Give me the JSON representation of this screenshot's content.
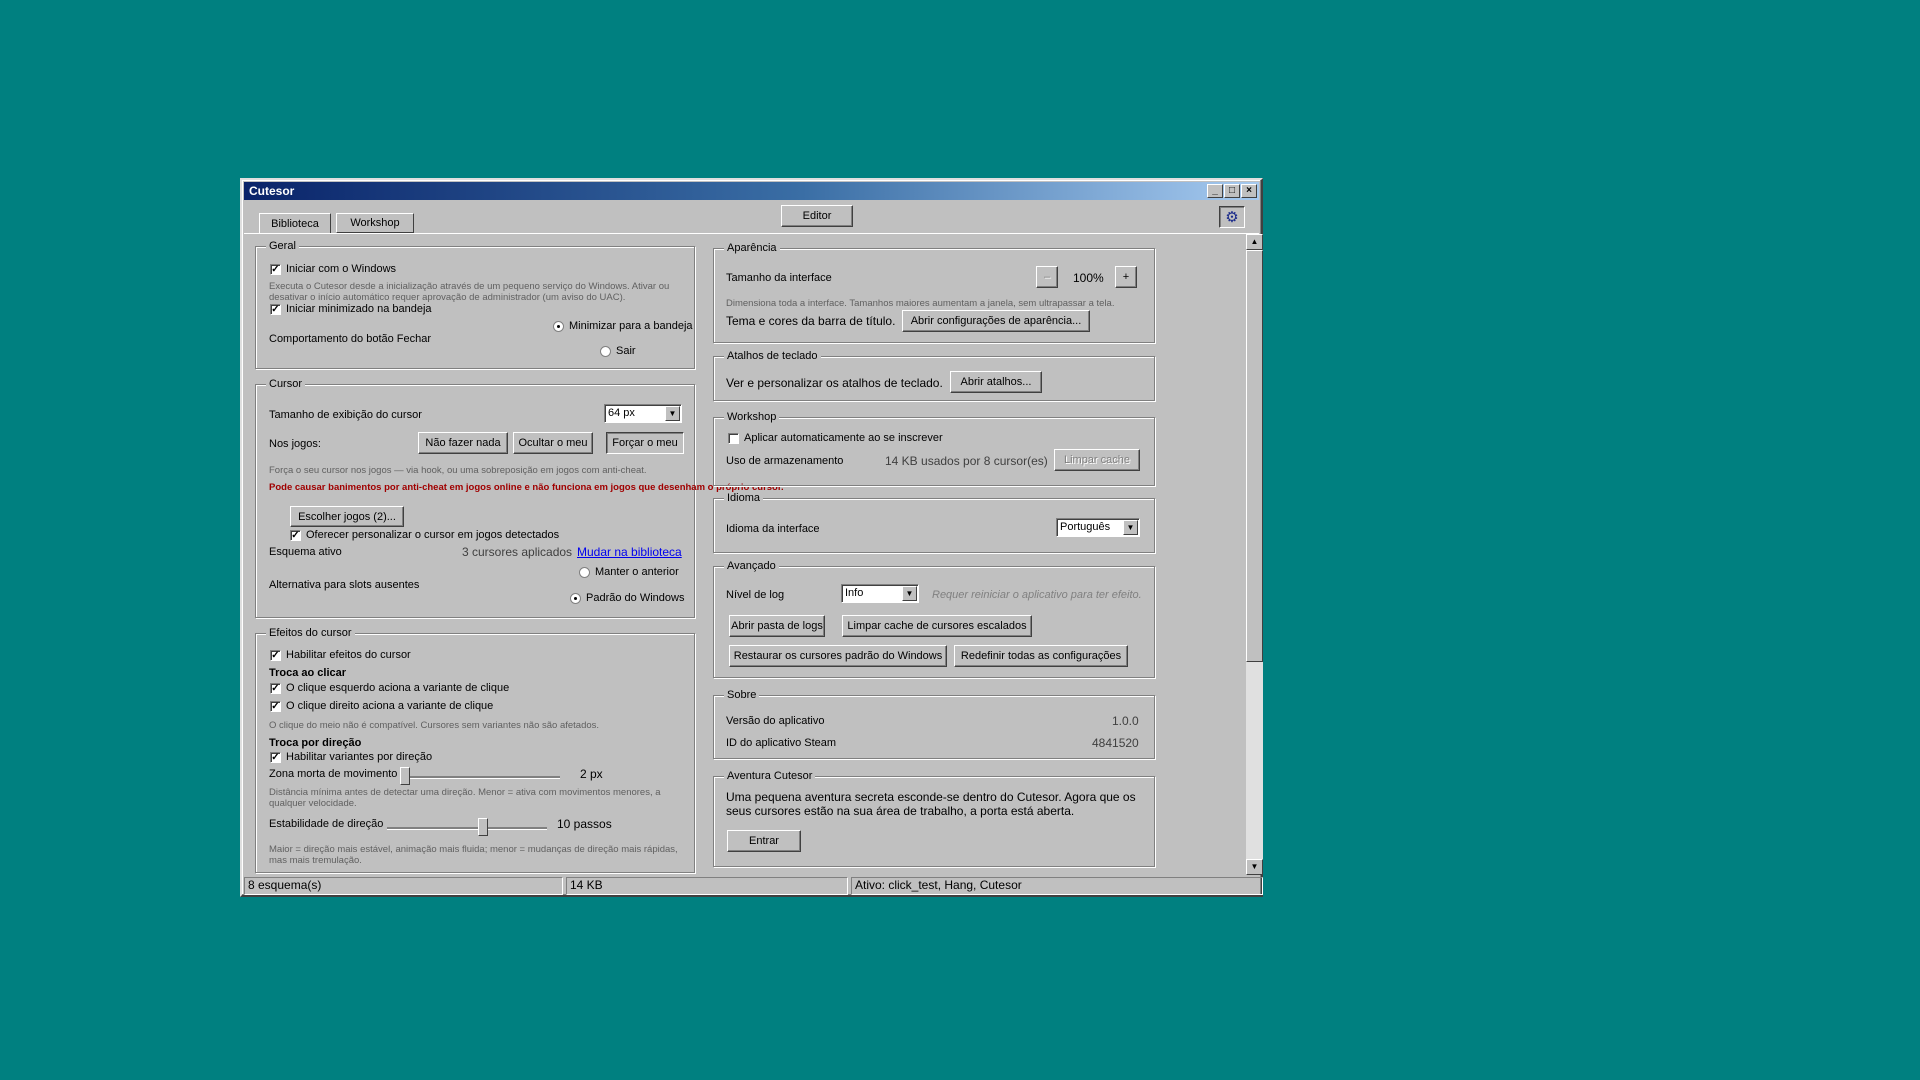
{
  "window": {
    "title": "Cutesor"
  },
  "tabs": [
    {
      "label": "Biblioteca"
    },
    {
      "label": "Workshop"
    }
  ],
  "editor_button": "Editor",
  "settings_icon": "gear-icon",
  "geral": {
    "title": "Geral",
    "start_with_windows": "Iniciar com o Windows",
    "start_desc": "Executa o Cutesor desde a inicialização através de um pequeno serviço do Windows. Ativar ou desativar o início automático requer aprovação de administrador (um aviso do UAC).",
    "start_minimized": "Iniciar minimizado na bandeja",
    "close_behavior": "Comportamento do botão Fechar",
    "minimize_tray": "Minimizar para a bandeja",
    "exit": "Sair"
  },
  "cursor": {
    "title": "Cursor",
    "size_label": "Tamanho de exibição do cursor",
    "size_value": "64 px",
    "games_label": "Nos jogos:",
    "btn_nothing": "Não fazer nada",
    "btn_hide": "Ocultar o meu",
    "btn_force": "Forçar o meu",
    "force_desc": "Força o seu cursor nos jogos — via hook, ou uma sobreposição em jogos com anti-cheat.",
    "warning": "Pode causar banimentos por anti-cheat em jogos online e não funciona em jogos que desenham o próprio cursor.",
    "choose_games": "Escolher jogos (2)...",
    "offer_custom": "Oferecer personalizar o cursor em jogos detectados",
    "active_scheme": "Esquema ativo",
    "cursors_applied": "3 cursores aplicados",
    "change_in_library": "Mudar na biblioteca",
    "keep_previous": "Manter o anterior",
    "fallback": "Alternativa para slots ausentes",
    "windows_default": "Padrão do Windows"
  },
  "effects": {
    "title": "Efeitos do cursor",
    "enable": "Habilitar efeitos do cursor",
    "click_swap": "Troca ao clicar",
    "left_click": "O clique esquerdo aciona a variante de clique",
    "right_click": "O clique direito aciona a variante de clique",
    "middle_note": "O clique do meio não é compatível. Cursores sem variantes não são afetados.",
    "dir_swap": "Troca por direção",
    "enable_dir": "Habilitar variantes por direção",
    "deadzone_label": "Zona morta de movimento",
    "deadzone_value": "2 px",
    "deadzone_level": 0.02,
    "deadzone_desc": "Distância mínima antes de detectar uma direção. Menor = ativa com movimentos menores, a qualquer velocidade.",
    "stability_label": "Estabilidade de direção",
    "stability_value": "10 passos",
    "stability_level": 0.6,
    "stability_desc": "Maior = direção mais estável, animação mais fluida; menor = mudanças de direção mais rápidas, mas mais tremulação."
  },
  "appearance": {
    "title": "Aparência",
    "size_label": "Tamanho da interface",
    "minus": "–",
    "zoom": "100%",
    "plus": "+",
    "desc": "Dimensiona toda a interface. Tamanhos maiores aumentam a janela, sem ultrapassar a tela.",
    "theme_label": "Tema e cores da barra de título.",
    "theme_btn": "Abrir configurações de aparência..."
  },
  "shortcuts": {
    "title": "Atalhos de teclado",
    "label": "Ver e personalizar os atalhos de teclado.",
    "btn": "Abrir atalhos..."
  },
  "workshop": {
    "title": "Workshop",
    "auto_apply": "Aplicar automaticamente ao se inscrever",
    "storage_label": "Uso de armazenamento",
    "storage_value": "14 KB usados por 8 cursor(es)",
    "clear_cache": "Limpar cache"
  },
  "language": {
    "title": "Idioma",
    "label": "Idioma da interface",
    "value": "Português"
  },
  "advanced": {
    "title": "Avançado",
    "log_label": "Nível de log",
    "log_value": "Info",
    "log_note": "Requer reiniciar o aplicativo para ter efeito.",
    "open_logs": "Abrir pasta de logs",
    "clear_scaled": "Limpar cache de cursores escalados",
    "restore_defaults": "Restaurar os cursores padrão do Windows",
    "reset_all": "Redefinir todas as configurações"
  },
  "about": {
    "title": "Sobre",
    "version_label": "Versão do aplicativo",
    "version_value": "1.0.0",
    "steam_label": "ID do aplicativo Steam",
    "steam_value": "4841520"
  },
  "adventure": {
    "title": "Aventura Cutesor",
    "desc": "Uma pequena aventura secreta esconde-se dentro do Cutesor. Agora que os seus cursores estão na sua área de trabalho, a porta está aberta.",
    "enter": "Entrar"
  },
  "status": {
    "schemes": "8 esquema(s)",
    "size": "14 KB",
    "active": "Ativo: click_test, Hang, Cutesor"
  }
}
